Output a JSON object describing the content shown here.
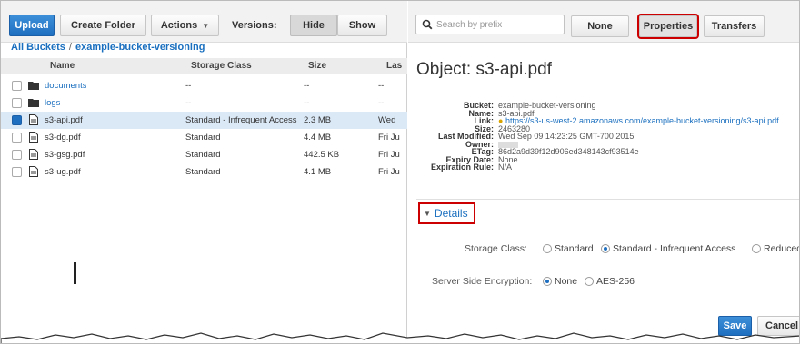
{
  "left": {
    "toolbar": {
      "upload": "Upload",
      "create_folder": "Create Folder",
      "actions": "Actions",
      "versions_label": "Versions:",
      "hide": "Hide",
      "show": "Show"
    },
    "breadcrumb": {
      "root": "All Buckets",
      "sep": "/",
      "bucket": "example-bucket-versioning"
    },
    "columns": [
      "Name",
      "Storage Class",
      "Size",
      "Las"
    ],
    "rows": [
      {
        "name": "documents",
        "type": "folder",
        "storage": "--",
        "size": "--",
        "last": "--"
      },
      {
        "name": "logs",
        "type": "folder",
        "storage": "--",
        "size": "--",
        "last": "--"
      },
      {
        "name": "s3-api.pdf",
        "type": "file",
        "storage": "Standard - Infrequent Access",
        "size": "2.3 MB",
        "last": "Wed"
      },
      {
        "name": "s3-dg.pdf",
        "type": "file",
        "storage": "Standard",
        "size": "4.4 MB",
        "last": "Fri Ju"
      },
      {
        "name": "s3-gsg.pdf",
        "type": "file",
        "storage": "Standard",
        "size": "442.5 KB",
        "last": "Fri Ju"
      },
      {
        "name": "s3-ug.pdf",
        "type": "file",
        "storage": "Standard",
        "size": "4.1 MB",
        "last": "Fri Ju"
      }
    ]
  },
  "right": {
    "search_placeholder": "Search by prefix",
    "buttons": {
      "none": "None",
      "properties": "Properties",
      "transfers": "Transfers"
    },
    "object_title": "Object: s3-api.pdf",
    "properties": {
      "bucket_label": "Bucket:",
      "bucket": "example-bucket-versioning",
      "name_label": "Name:",
      "name": "s3-api.pdf",
      "link_label": "Link:",
      "link": "https://s3-us-west-2.amazonaws.com/example-bucket-versioning/s3-api.pdf",
      "size_label": "Size:",
      "size": "2463280",
      "modified_label": "Last Modified:",
      "modified": "Wed Sep 09 14:23:25 GMT-700 2015",
      "owner_label": "Owner:",
      "etag_label": "ETag:",
      "etag": "86d2a9d39f12d906ed348143cf93514e",
      "expiry_label": "Expiry Date:",
      "expiry": "None",
      "rule_label": "Expiration Rule:",
      "rule": "N/A"
    },
    "details_label": "Details",
    "storage_class": {
      "label": "Storage Class:",
      "options": [
        "Standard",
        "Standard - Infrequent Access",
        "Reduced"
      ],
      "selected": "Standard - Infrequent Access"
    },
    "encryption": {
      "label": "Server Side Encryption:",
      "options": [
        "None",
        "AES-256"
      ],
      "selected": "None"
    },
    "save": "Save",
    "cancel": "Cancel"
  },
  "colors": {
    "accent": "#1f6fc0",
    "highlight": "#cc0000",
    "link": "#1a6fbf"
  }
}
